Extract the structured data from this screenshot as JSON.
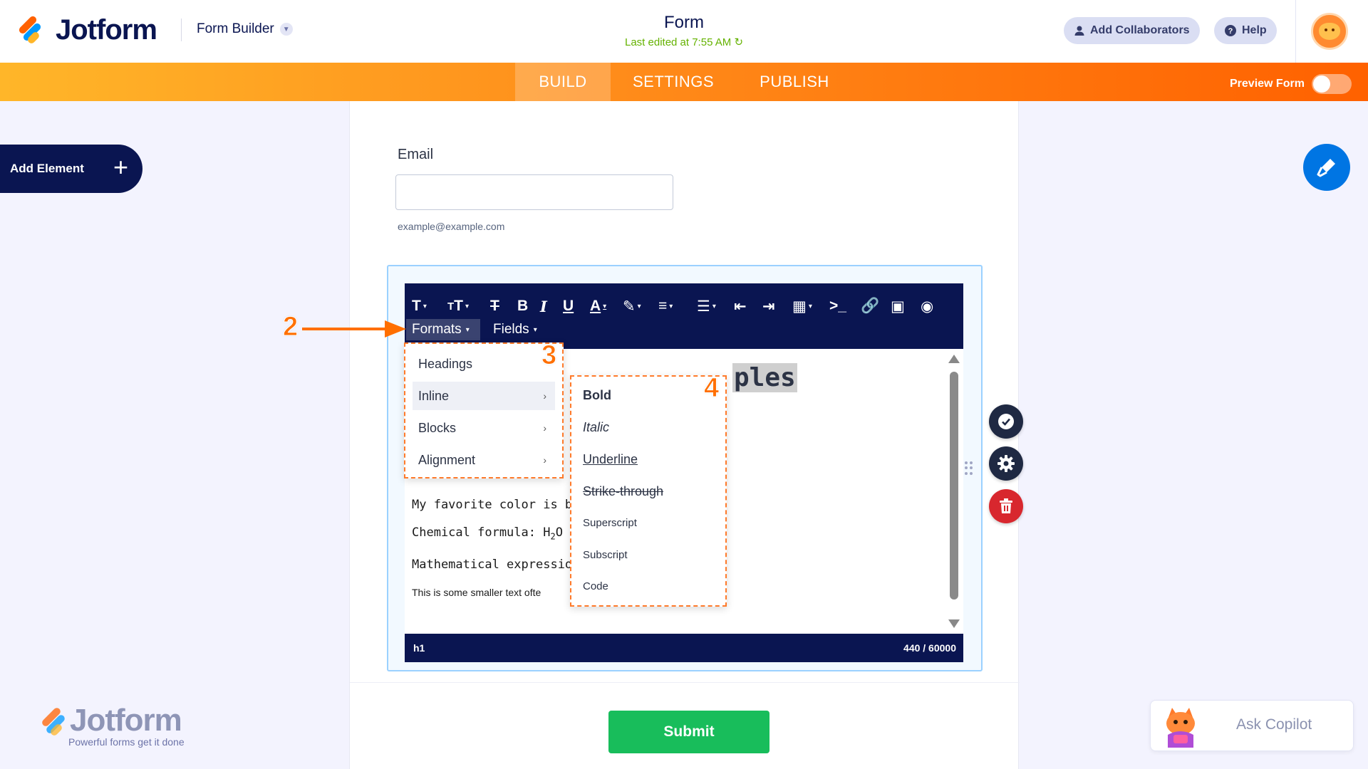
{
  "header": {
    "logo_text": "Jotform",
    "builder_label": "Form Builder",
    "form_title": "Form",
    "last_edited": "Last edited at 7:55 AM",
    "add_collaborators": "Add Collaborators",
    "help": "Help"
  },
  "nav": {
    "tabs": [
      "BUILD",
      "SETTINGS",
      "PUBLISH"
    ],
    "active_tab": "BUILD",
    "preview_label": "Preview Form",
    "preview_enabled": false
  },
  "sidebar": {
    "add_element": "Add Element"
  },
  "form": {
    "email_label": "Email",
    "email_value": "",
    "email_hint": "example@example.com",
    "submit_label": "Submit"
  },
  "editor": {
    "menus": {
      "formats": "Formats",
      "fields": "Fields"
    },
    "heading_fragment": "ples",
    "lines": [
      "My favorite color is blue",
      "Chemical formula: H",
      "Mathematical expression",
      "This is some smaller text ofte"
    ],
    "subscript": "2",
    "formula_tail": "O",
    "status_path": "h1",
    "char_count": "440 / 60000"
  },
  "formats_menu": {
    "items": [
      "Headings",
      "Inline",
      "Blocks",
      "Alignment"
    ],
    "active": "Inline"
  },
  "inline_menu": {
    "items": [
      "Bold",
      "Italic",
      "Underline",
      "Strike-through",
      "Superscript",
      "Subscript",
      "Code"
    ]
  },
  "annotations": {
    "step2": "2",
    "step3": "3",
    "step4": "4"
  },
  "footer": {
    "brand": "Jotform",
    "tagline": "Powerful forms get it done",
    "copilot": "Ask Copilot"
  },
  "colors": {
    "navy": "#0a1551",
    "orange": "#ff6100",
    "green_submit": "#18bd5b",
    "blue_accent": "#0075e3",
    "delete_red": "#d8272e"
  }
}
